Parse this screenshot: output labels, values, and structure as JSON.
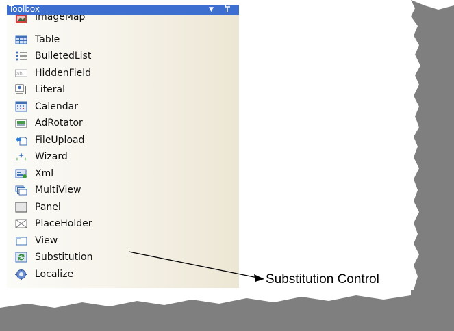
{
  "toolbox": {
    "title": "Toolbox",
    "dropdown_glyph": "▼",
    "pin_glyph": "ᛘ"
  },
  "tools": [
    {
      "label": "ImageMap",
      "icon": "imagemap-icon"
    },
    {
      "label": "Table",
      "icon": "table-icon"
    },
    {
      "label": "BulletedList",
      "icon": "bulleted-list-icon"
    },
    {
      "label": "HiddenField",
      "icon": "hidden-field-icon"
    },
    {
      "label": "Literal",
      "icon": "literal-icon"
    },
    {
      "label": "Calendar",
      "icon": "calendar-icon"
    },
    {
      "label": "AdRotator",
      "icon": "ad-rotator-icon"
    },
    {
      "label": "FileUpload",
      "icon": "file-upload-icon"
    },
    {
      "label": "Wizard",
      "icon": "wizard-icon"
    },
    {
      "label": "Xml",
      "icon": "xml-icon"
    },
    {
      "label": "MultiView",
      "icon": "multiview-icon"
    },
    {
      "label": "Panel",
      "icon": "panel-icon"
    },
    {
      "label": "PlaceHolder",
      "icon": "placeholder-icon"
    },
    {
      "label": "View",
      "icon": "view-icon"
    },
    {
      "label": "Substitution",
      "icon": "substitution-icon"
    },
    {
      "label": "Localize",
      "icon": "localize-icon"
    }
  ],
  "callout": {
    "label": "Substitution Control"
  },
  "colors": {
    "header": "#3c6fcf",
    "backdrop": "#7f7f7f"
  }
}
